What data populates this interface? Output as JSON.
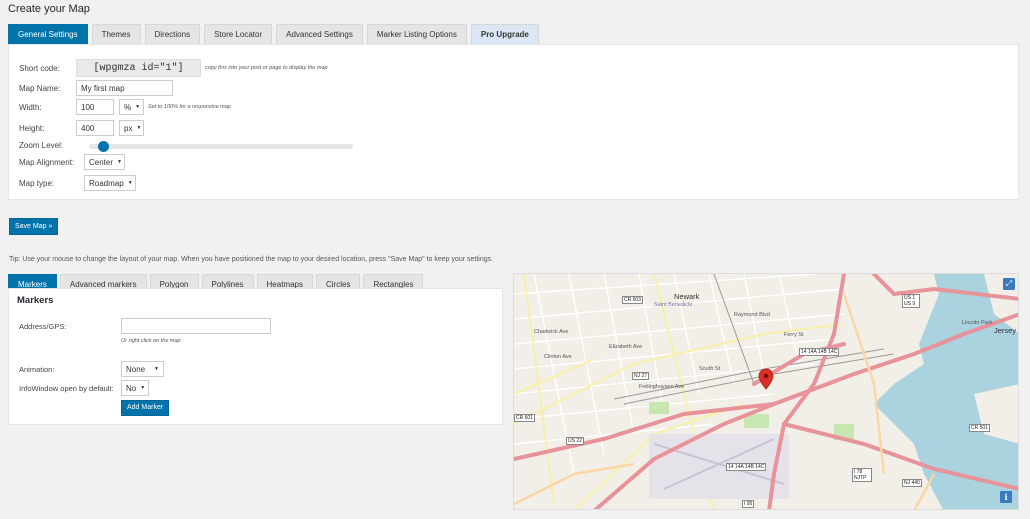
{
  "page": {
    "title": "Create your Map"
  },
  "tabs": [
    {
      "label": "General Settings",
      "active": true
    },
    {
      "label": "Themes"
    },
    {
      "label": "Directions"
    },
    {
      "label": "Store Locator"
    },
    {
      "label": "Advanced Settings"
    },
    {
      "label": "Marker Listing Options"
    },
    {
      "label": "Pro Upgrade"
    }
  ],
  "general": {
    "shortcode_label": "Short code:",
    "shortcode_value": "[wpgmza id=\"1\"]",
    "shortcode_hint": "copy this into your post or page to display the map",
    "map_name_label": "Map Name:",
    "map_name_value": "My first map",
    "width_label": "Width:",
    "width_value": "100",
    "width_unit": "%",
    "width_hint": "Set to 100% for a responsive map",
    "height_label": "Height:",
    "height_value": "400",
    "height_unit": "px",
    "zoom_label": "Zoom Level:",
    "zoom_level": 0.02,
    "alignment_label": "Map Alignment:",
    "alignment_value": "Center",
    "maptype_label": "Map type:",
    "maptype_value": "Roadmap"
  },
  "save_button": "Save Map »",
  "tip": "Tip: Use your mouse to change the layout of your map. When you have positioned the map to your desired location, press \"Save Map\" to keep your settings.",
  "marker_tabs": [
    {
      "label": "Markers",
      "active": true
    },
    {
      "label": "Advanced markers"
    },
    {
      "label": "Polygon"
    },
    {
      "label": "Polylines"
    },
    {
      "label": "Heatmaps"
    },
    {
      "label": "Circles"
    },
    {
      "label": "Rectangles"
    }
  ],
  "markers": {
    "title": "Markers",
    "address_label": "Address/GPS:",
    "address_value": "",
    "address_hint": "Or right click on the map",
    "animation_label": "Animation:",
    "animation_value": "None",
    "infowindow_label": "InfoWindow open by default:",
    "infowindow_value": "No",
    "add_button": "Add Marker"
  },
  "map": {
    "labels": {
      "newark": "Newark",
      "jersey": "Jersey",
      "lincoln_park": "Lincoln Park",
      "saint_benedicts": "Saint Benedicts",
      "chadwick": "Chadwick Ave",
      "clinton": "Clinton Ave",
      "elizabeth": "Elizabeth Ave",
      "frelinghuysen": "Frelinghuysen Ave",
      "south": "South St",
      "ferry": "Ferry St",
      "raymond": "Raymond Blvd"
    },
    "shields": {
      "cr603": "CR 603",
      "us1_9": "US 1 US 9",
      "nj27": "NJ 27",
      "cr601": "CR 601",
      "us22": "US 22",
      "i14": "14 14A 14B 14C",
      "i14b": "14 14A 14B 14C",
      "i78": "I 78 NJTP",
      "nj440": "NJ 440",
      "cr501": "CR 501",
      "i95": "I 95"
    },
    "marker_color": "#d93025",
    "water_color": "#aad3df",
    "park_color": "#c8e6b0",
    "highway_color": "#e8929a"
  }
}
